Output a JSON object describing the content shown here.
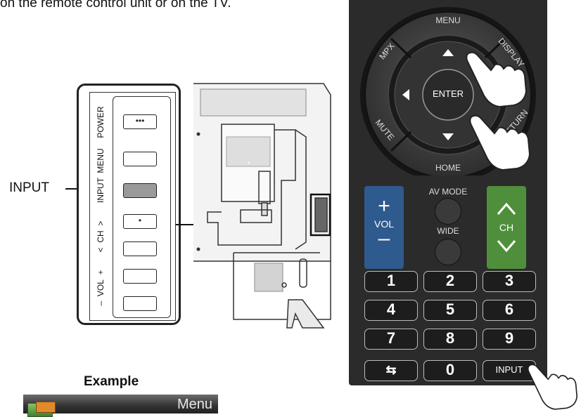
{
  "header": {
    "instruction_text": "on the remote control unit or on the TV."
  },
  "callout": {
    "input_label": "INPUT"
  },
  "side_panel": {
    "labels": {
      "power": "POWER",
      "menu": "MENU",
      "input": "INPUT",
      "ch": "CH",
      "vol": "VOL"
    },
    "buttons": [
      {
        "id": "power",
        "glyph": "•••"
      },
      {
        "id": "menu",
        "glyph": ""
      },
      {
        "id": "input",
        "glyph": ""
      },
      {
        "id": "ch_up",
        "glyph": "•"
      },
      {
        "id": "ch_down",
        "glyph": ""
      },
      {
        "id": "vol_up",
        "glyph": ""
      },
      {
        "id": "vol_down",
        "glyph": ""
      }
    ]
  },
  "remote": {
    "ring_labels": {
      "menu": "MENU",
      "mpx": "MPX",
      "display": "DISPLAY",
      "mute": "MUTE",
      "return": "RETURN",
      "home": "HOME"
    },
    "center": "ENTER",
    "vol": {
      "plus": "+",
      "label": "VOL",
      "minus": "–"
    },
    "ch": {
      "label": "CH"
    },
    "av_mode": "AV MODE",
    "wide": "WIDE",
    "number_keys": [
      "1",
      "2",
      "3",
      "4",
      "5",
      "6",
      "7",
      "8",
      "9"
    ],
    "bottom_keys": {
      "flashback_glyph": "⇆",
      "zero": "0",
      "input": "INPUT"
    },
    "colors": {
      "body": "#2b2b2b",
      "vol": "#2f5a8e",
      "ch": "#4f8f3c"
    }
  },
  "example": {
    "label": "Example",
    "menu_title": "Menu"
  }
}
